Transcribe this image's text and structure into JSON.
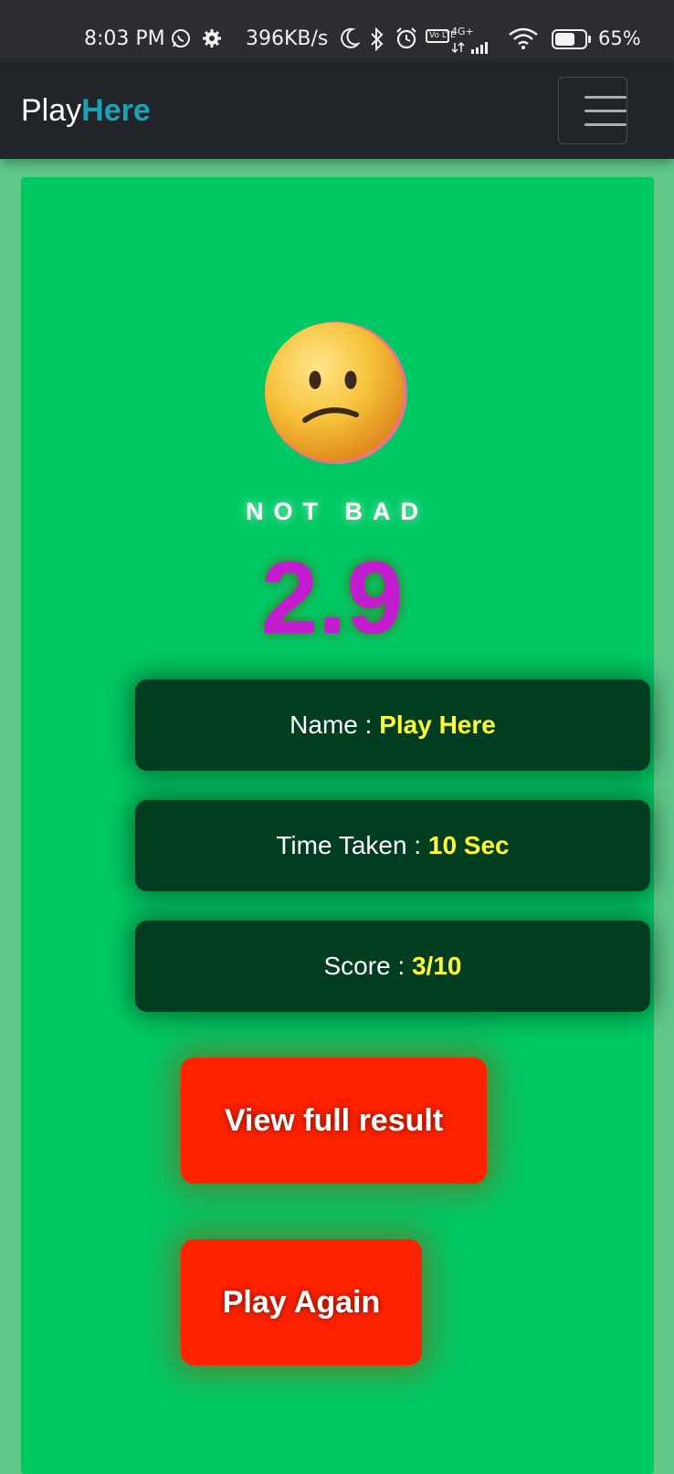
{
  "status_bar": {
    "time": "8:03 PM",
    "speed": "396KB/s",
    "network": "4G+",
    "volte": "Vo LTE",
    "battery": "65%",
    "icons": [
      "whatsapp-icon",
      "settings-gear-icon",
      "moon-icon",
      "bluetooth-icon",
      "alarm-icon",
      "volte-icon",
      "signal-icon",
      "wifi-icon",
      "battery-icon"
    ]
  },
  "navbar": {
    "brand_part1": "Play",
    "brand_part2": "Here",
    "menu_icon": "hamburger-menu-icon",
    "accent_color": "#17a2b8"
  },
  "result": {
    "emoji": "confused-face-emoji",
    "verdict": "NOT BAD",
    "rating": "2.9"
  },
  "info": {
    "name_label": "Name : ",
    "name_value": "Play Here",
    "time_label": "Time Taken : ",
    "time_value": "10 Sec",
    "score_label": "Score : ",
    "score_value": "3/10"
  },
  "buttons": {
    "view_full_result": "View full result",
    "play_again": "Play Again"
  },
  "colors": {
    "card_bg": "#00c964",
    "info_bg": "#013d20",
    "value_color": "#ffff33",
    "rating_color": "#c21bd0",
    "button_bg": "#ff2200"
  }
}
